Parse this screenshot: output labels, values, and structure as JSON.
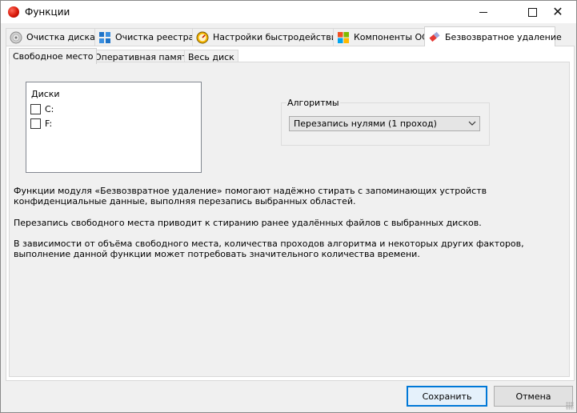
{
  "window": {
    "title": "Функции",
    "minimize": "–",
    "maximize": "☐",
    "close": "✕"
  },
  "tabs": [
    {
      "label": "Очистка диска",
      "icon": "disk-icon"
    },
    {
      "label": "Очистка реестра",
      "icon": "registry-icon"
    },
    {
      "label": "Настройки быстродействия",
      "icon": "speedometer-icon"
    },
    {
      "label": "Компоненты ОС",
      "icon": "windows-logo-icon"
    },
    {
      "label": "Безвозвратное удаление",
      "icon": "eraser-icon",
      "active": true
    }
  ],
  "subtabs": [
    {
      "label": "Свободное место",
      "active": true
    },
    {
      "label": "Оперативная память"
    },
    {
      "label": "Весь диск"
    }
  ],
  "disks": {
    "title": "Диски",
    "items": [
      {
        "label": "C:",
        "checked": false
      },
      {
        "label": "F:",
        "checked": false
      }
    ]
  },
  "algorithms": {
    "title": "Алгоритмы",
    "selected": "Перезапись нулями (1 проход)"
  },
  "info": {
    "p1": "Функции модуля «Безвозвратное удаление» помогают надёжно стирать с запоминающих устройств конфиденциальные данные, выполняя перезапись выбранных областей.",
    "p2": "Перезапись свободного места приводит к стиранию ранее удалённых файлов с выбранных дисков.",
    "p3": "В зависимости от объёма свободного места, количества проходов алгоритма и некоторых других факторов, выполнение данной функции может потребовать значительного количества времени."
  },
  "buttons": {
    "save": "Сохранить",
    "cancel": "Отмена"
  },
  "colors": {
    "accent": "#0078d7",
    "window_bg": "#f0f0f0"
  }
}
